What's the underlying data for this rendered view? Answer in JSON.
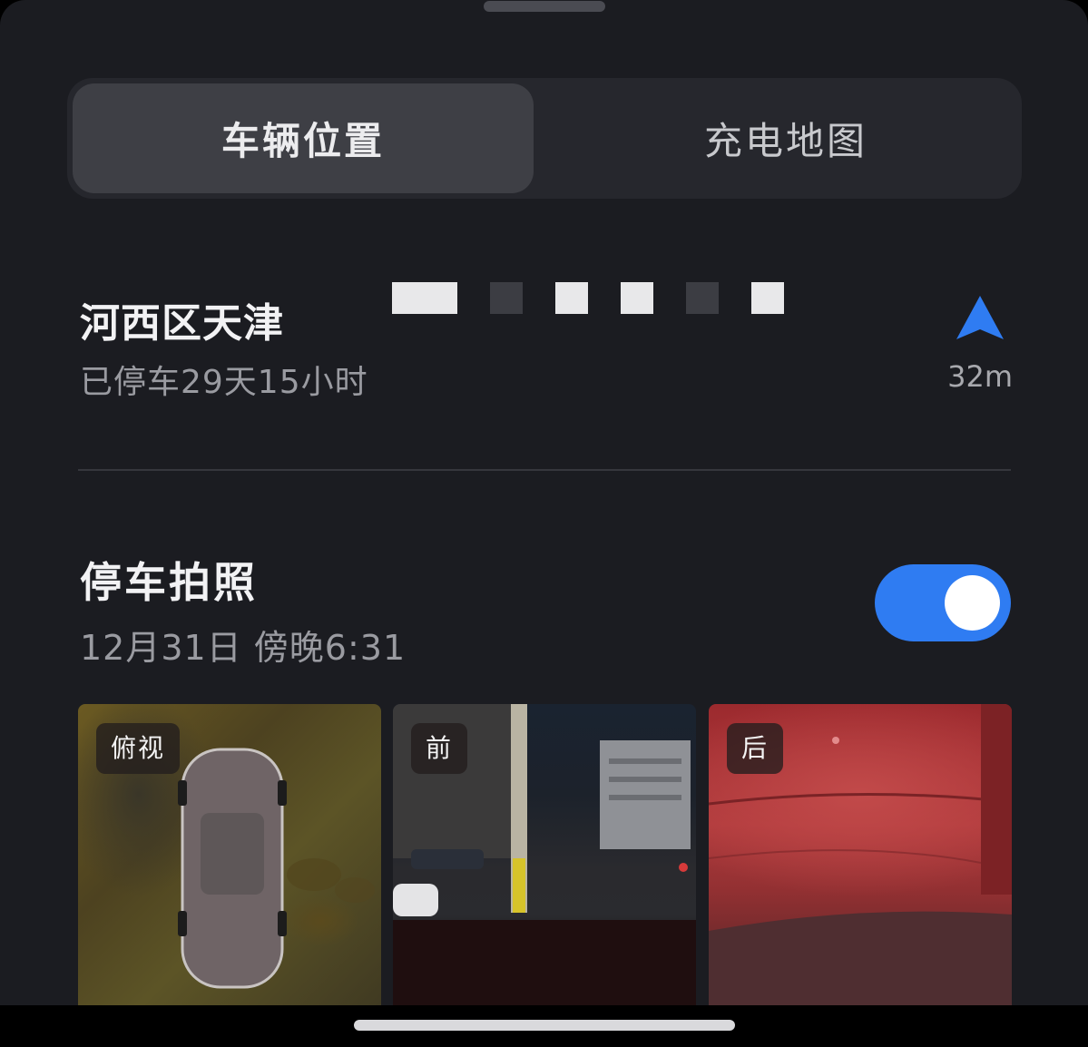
{
  "tabs": [
    {
      "label": "车辆位置",
      "active": true
    },
    {
      "label": "充电地图",
      "active": false
    }
  ],
  "location": {
    "address": "河西区天津",
    "parked_duration": "已停车29天15小时",
    "distance": "32m"
  },
  "parking_photo": {
    "title": "停车拍照",
    "timestamp": "12月31日 傍晚6:31",
    "toggle_on": true
  },
  "photos": [
    {
      "label": "俯视"
    },
    {
      "label": "前"
    },
    {
      "label": "后"
    }
  ],
  "colors": {
    "accent": "#2f7cf2",
    "background": "#1b1c21",
    "segment_bg": "#26272d",
    "segment_active": "#3e3f45"
  }
}
